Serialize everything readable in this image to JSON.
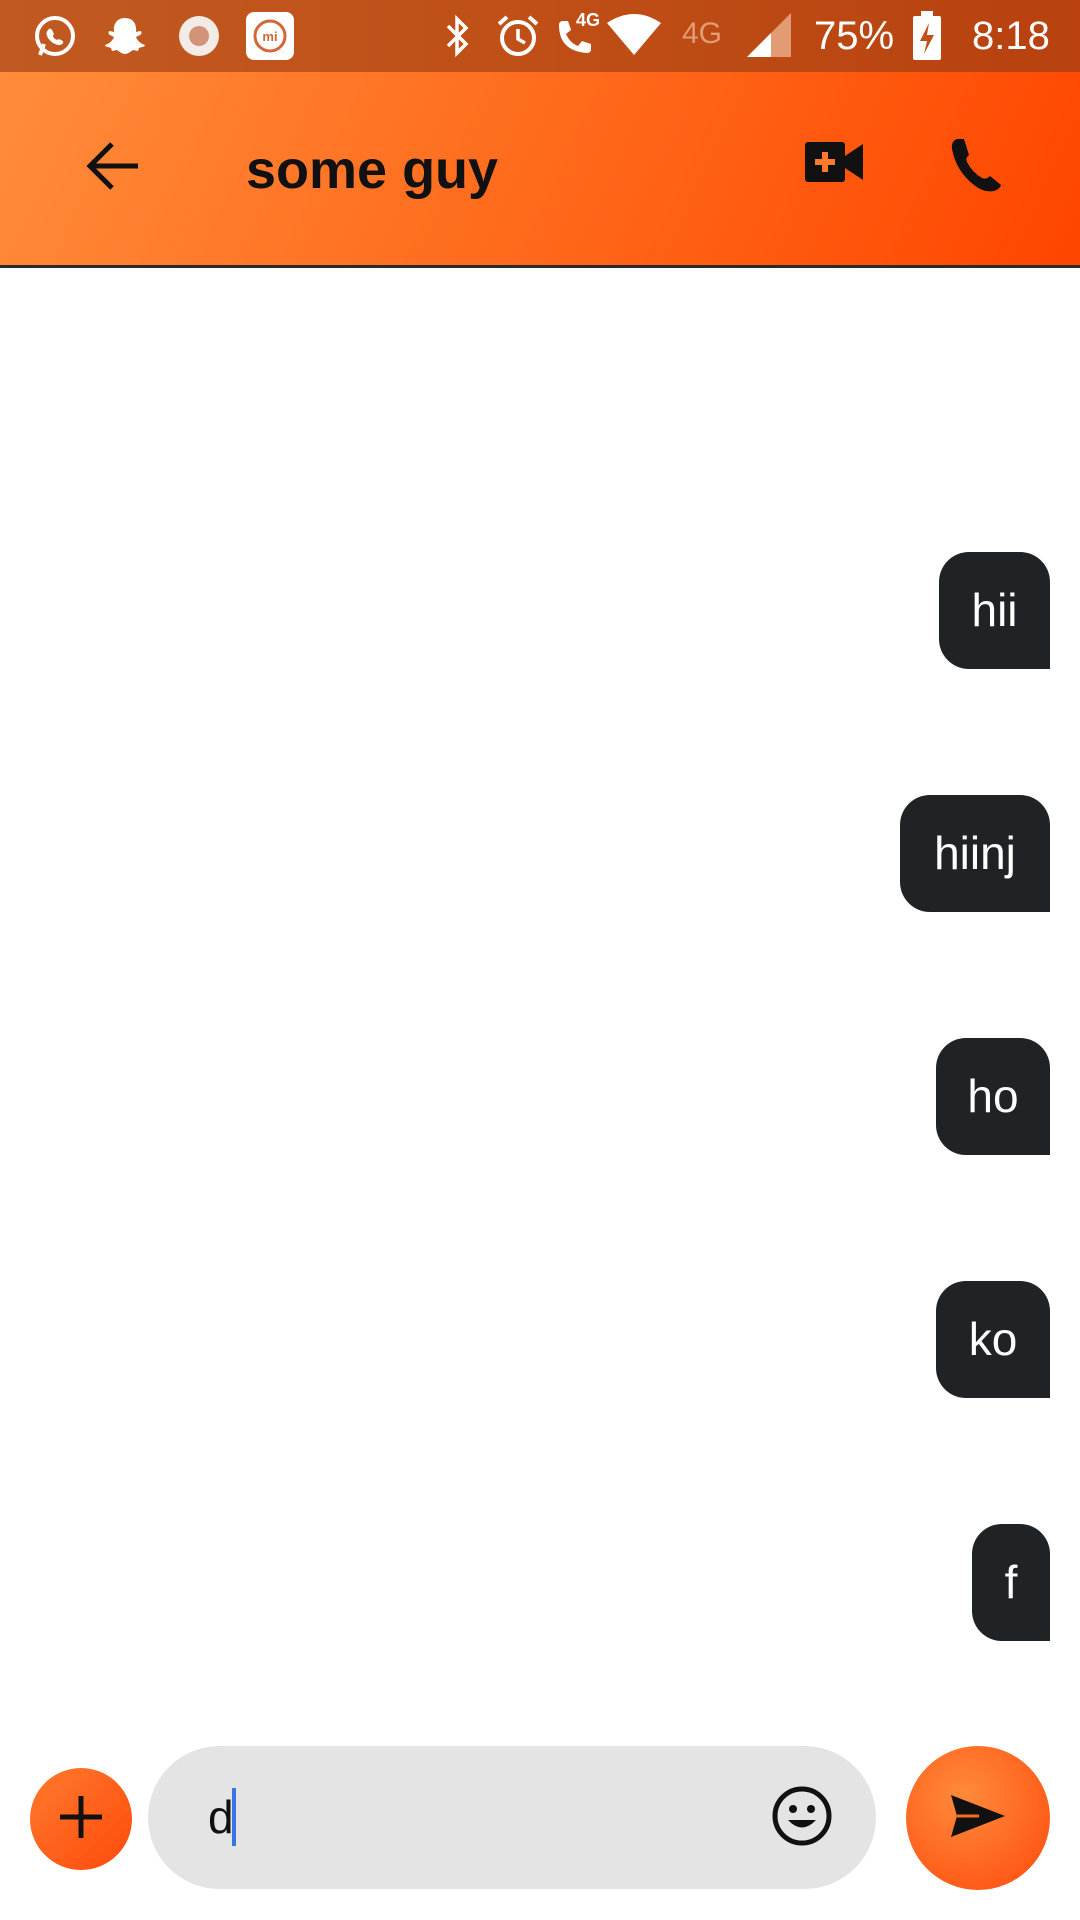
{
  "status_bar": {
    "network_small": "4G",
    "network": "4G",
    "battery_percent": "75%",
    "time": "8:18",
    "icons": [
      "whatsapp-icon",
      "snapchat-icon",
      "record-icon",
      "mi-icon",
      "bluetooth-icon",
      "alarm-icon",
      "volte-call-icon",
      "wifi-icon",
      "signal-icon",
      "battery-charging-icon"
    ]
  },
  "header": {
    "title": "some guy",
    "icons": [
      "back-arrow-icon",
      "video-call-icon",
      "phone-icon"
    ]
  },
  "messages": [
    {
      "text": "hii"
    },
    {
      "text": "hiinj"
    },
    {
      "text": "ho"
    },
    {
      "text": "ko"
    },
    {
      "text": "f"
    }
  ],
  "composer": {
    "value": "d",
    "icons": [
      "add-icon",
      "emoji-icon",
      "send-icon"
    ]
  },
  "colors": {
    "accent": "#ff6a1c",
    "bubble": "#1f2326",
    "input_bg": "#e4e4e4"
  }
}
